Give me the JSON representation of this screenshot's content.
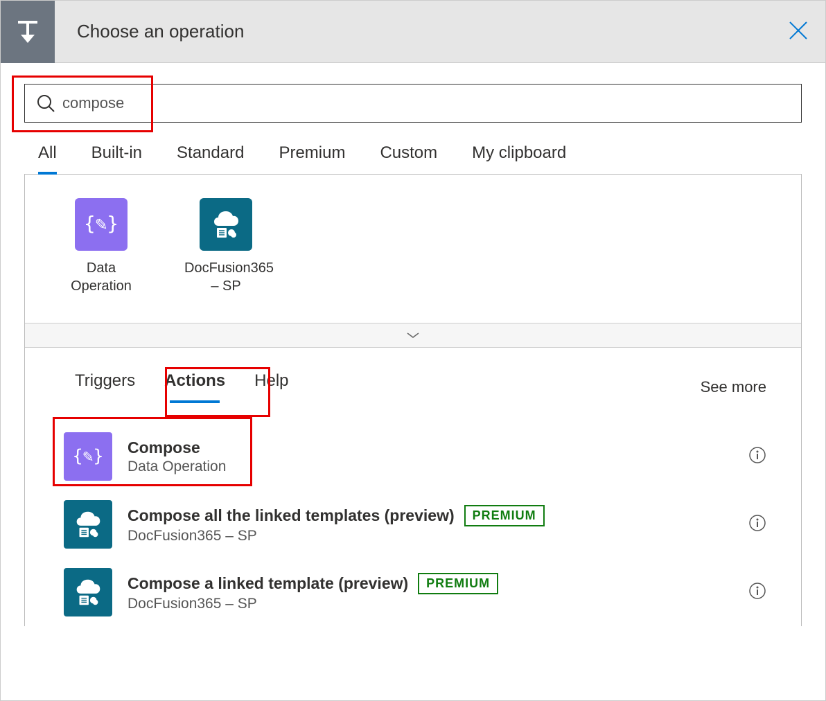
{
  "header": {
    "title": "Choose an operation"
  },
  "search": {
    "value": "compose"
  },
  "tabs": [
    {
      "label": "All",
      "active": true
    },
    {
      "label": "Built-in",
      "active": false
    },
    {
      "label": "Standard",
      "active": false
    },
    {
      "label": "Premium",
      "active": false
    },
    {
      "label": "Custom",
      "active": false
    },
    {
      "label": "My clipboard",
      "active": false
    }
  ],
  "connectors": [
    {
      "label": "Data Operation",
      "icon": "data-op"
    },
    {
      "label": "DocFusion365 – SP",
      "icon": "docfusion"
    }
  ],
  "subtabs": [
    {
      "label": "Triggers",
      "active": false
    },
    {
      "label": "Actions",
      "active": true
    },
    {
      "label": "Help",
      "active": false
    }
  ],
  "see_more": "See more",
  "actions": [
    {
      "title": "Compose",
      "subtitle": "Data Operation",
      "icon": "data-op",
      "premium": false
    },
    {
      "title": "Compose all the linked templates (preview)",
      "subtitle": "DocFusion365 – SP",
      "icon": "docfusion",
      "premium": true
    },
    {
      "title": "Compose a linked template (preview)",
      "subtitle": "DocFusion365 – SP",
      "icon": "docfusion",
      "premium": true
    }
  ],
  "premium_label": "PREMIUM"
}
